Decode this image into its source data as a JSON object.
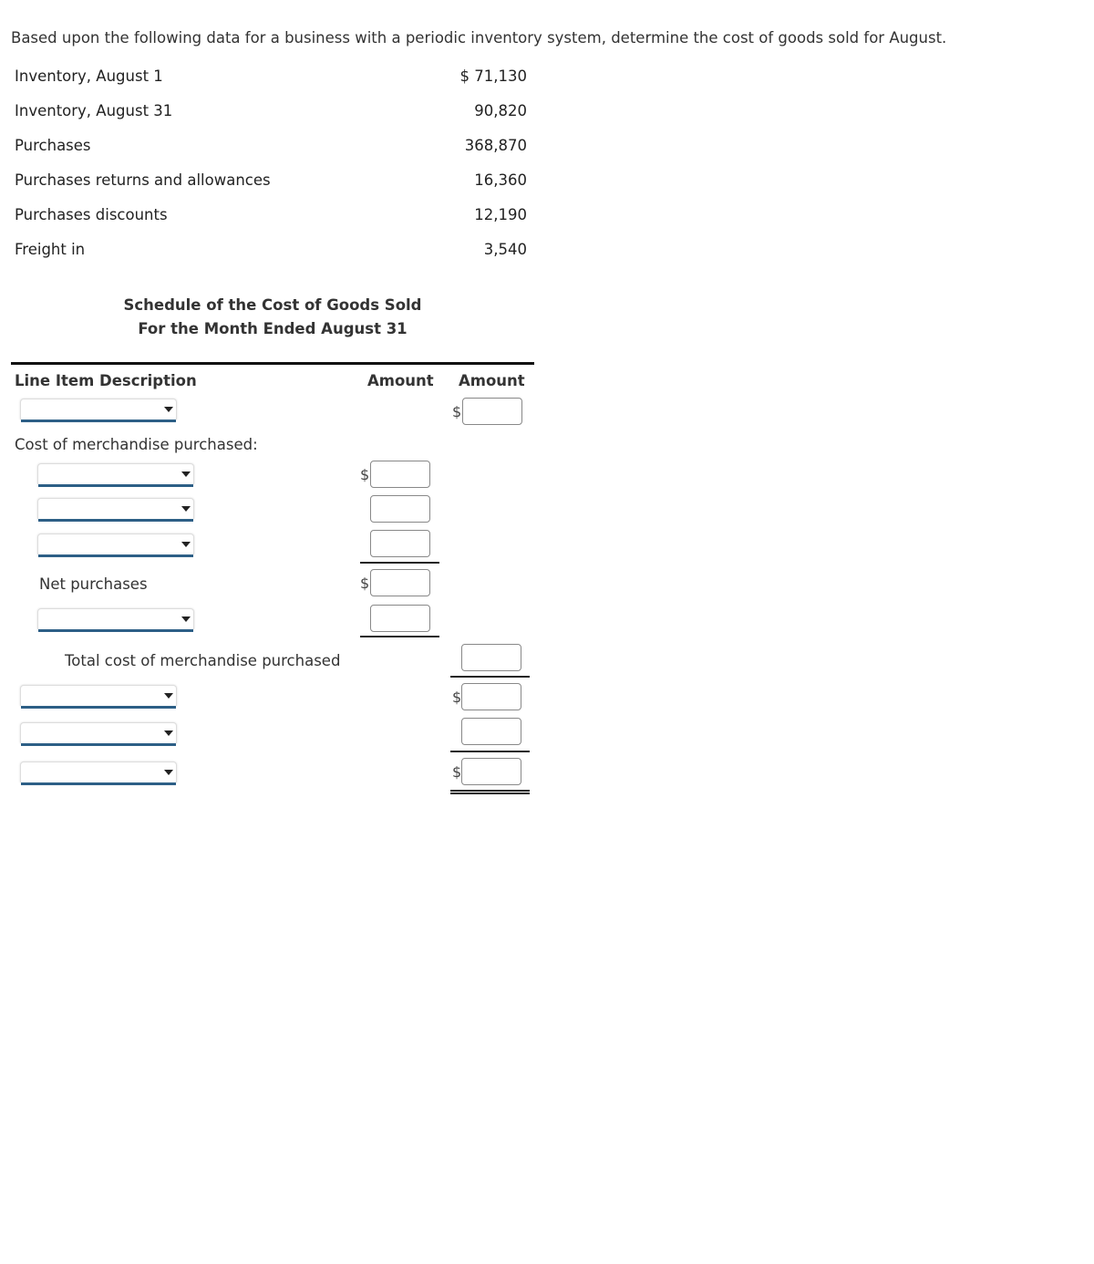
{
  "question": {
    "text": "Based upon the following data for a business with a periodic inventory system, determine the cost of goods sold for August."
  },
  "given_data": [
    {
      "label": "Inventory, August 1",
      "value": "$ 71,130"
    },
    {
      "label": "Inventory, August 31",
      "value": "90,820"
    },
    {
      "label": "Purchases",
      "value": "368,870"
    },
    {
      "label": "Purchases returns and allowances",
      "value": "16,360"
    },
    {
      "label": "Purchases discounts",
      "value": "12,190"
    },
    {
      "label": "Freight in",
      "value": "3,540"
    }
  ],
  "schedule": {
    "title_line1": "Schedule of the Cost of Goods Sold",
    "title_line2": "For the Month Ended August 31",
    "headers": {
      "description": "Line Item Description",
      "amount1": "Amount",
      "amount2": "Amount"
    },
    "labels": {
      "cost_of_merchandise": "Cost of merchandise purchased:",
      "net_purchases": "Net purchases",
      "total_cost": "Total cost of merchandise purchased"
    },
    "currency_symbol": "$",
    "selects": [
      "",
      "",
      "",
      "",
      "",
      "",
      "",
      ""
    ],
    "inputs": [
      "",
      "",
      "",
      "",
      "",
      "",
      "",
      "",
      "",
      "",
      ""
    ]
  }
}
